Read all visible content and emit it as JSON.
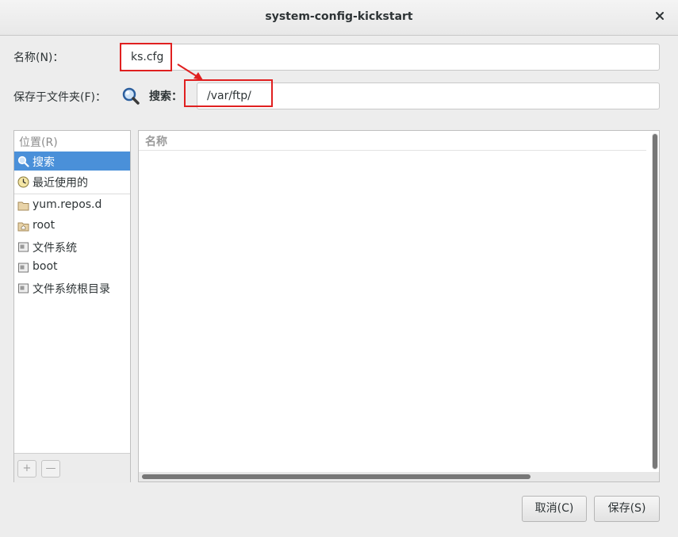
{
  "window": {
    "title": "system-config-kickstart"
  },
  "form": {
    "name_label": "名称(N)：",
    "name_value": "ks.cfg",
    "save_in_label": "保存于文件夹(F)：",
    "search_label": "搜索：",
    "path_value": "/var/ftp/"
  },
  "places": {
    "header": "位置(R)",
    "items": [
      {
        "label": "搜索",
        "icon": "search-icon",
        "selected": true
      },
      {
        "label": "最近使用的",
        "icon": "clock-icon"
      },
      {
        "label": "yum.repos.d",
        "icon": "folder-icon"
      },
      {
        "label": "root",
        "icon": "home-folder-icon"
      },
      {
        "label": "文件系统",
        "icon": "drive-icon"
      },
      {
        "label": "boot",
        "icon": "drive-icon"
      },
      {
        "label": "文件系统根目录",
        "icon": "drive-icon"
      }
    ],
    "add_label": "+",
    "remove_label": "—"
  },
  "files": {
    "column_name": "名称"
  },
  "buttons": {
    "cancel": "取消(C)",
    "save": "保存(S)"
  },
  "colors": {
    "selection": "#4a90d9",
    "annotation_red": "#e02020"
  }
}
